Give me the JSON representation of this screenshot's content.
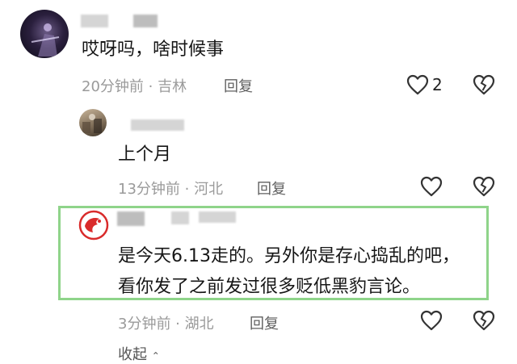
{
  "comments": [
    {
      "text": "哎呀吗，啥时候事",
      "time": "20分钟前 · 吉林",
      "reply_label": "回复",
      "like_count": "2"
    },
    {
      "text": "上个月",
      "time": "13分钟前 · 河北",
      "reply_label": "回复"
    },
    {
      "text_line1": "是今天6.13走的。另外你是存心捣乱的吧，",
      "text_line2": "看你发了之前发过很多贬低黑豹言论。",
      "time": "3分钟前 · 湖北",
      "reply_label": "回复"
    }
  ],
  "collapse_label": "收起",
  "colors": {
    "highlight_border": "#8fd48a",
    "meta_text": "#9a9a9a"
  }
}
